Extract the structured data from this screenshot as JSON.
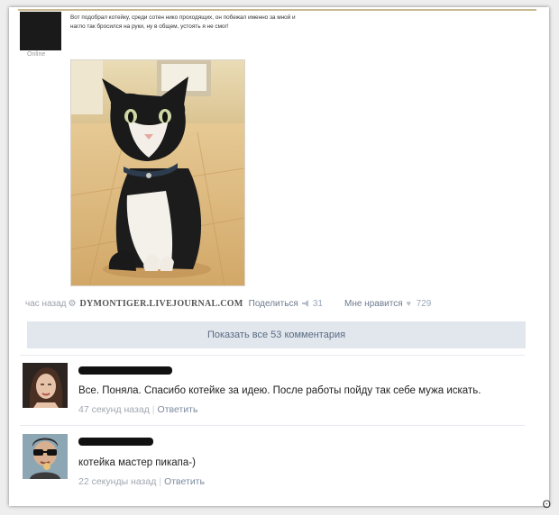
{
  "post": {
    "online_label": "Online",
    "text": "Вот подобрал котейку, среди сотен нико проходящих, он побежал именно за мной и нагло так бросился на руки, ну в общем, устоять я не смог!",
    "time": "час назад",
    "source": "DYMONTIGER.LIVEJOURNAL.COM",
    "share_label": "Поделиться",
    "share_count": "31",
    "like_label": "Мне нравится",
    "like_count": "729"
  },
  "comments_toggle": {
    "label": "Показать все 53 комментария"
  },
  "comments": [
    {
      "text": "Все. Поняла. Спасибо котейке за идею. После работы пойду так себе мужа искать.",
      "time": "47 секунд назад",
      "reply": "Ответить"
    },
    {
      "text": "котейка мастер пикапа-)",
      "time": "22 секунды назад",
      "reply": "Ответить"
    }
  ],
  "watermark": "ʘ"
}
